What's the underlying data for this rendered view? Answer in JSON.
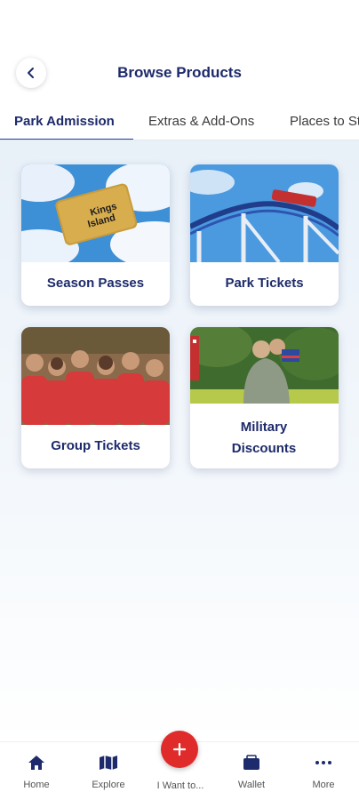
{
  "header": {
    "title": "Browse Products",
    "back_icon": "chevron-left-icon"
  },
  "tabs": [
    {
      "label": "Park Admission",
      "active": true
    },
    {
      "label": "Extras & Add-Ons",
      "active": false
    },
    {
      "label": "Places to Stay",
      "active": false
    }
  ],
  "products": [
    {
      "label": "Season Passes",
      "image": "gold season pass card over blue sky"
    },
    {
      "label": "Park Tickets",
      "image": "roller coaster against blue sky"
    },
    {
      "label": "Group Tickets",
      "image": "group of people in red shirts"
    },
    {
      "label": "Military Discounts",
      "image": "soldier hugging child with flag"
    }
  ],
  "pass_card": {
    "brand_line1": "Kings",
    "brand_line2": "Island"
  },
  "bottom_nav": {
    "items": [
      {
        "label": "Home",
        "icon": "home-icon"
      },
      {
        "label": "Explore",
        "icon": "map-icon"
      },
      {
        "label": "I Want to...",
        "icon": "plus-icon"
      },
      {
        "label": "Wallet",
        "icon": "wallet-icon"
      },
      {
        "label": "More",
        "icon": "more-icon"
      }
    ]
  },
  "colors": {
    "brand_navy": "#1d2a6b",
    "accent_red": "#e02b2b",
    "tab_underline": "#1d3fa0"
  }
}
